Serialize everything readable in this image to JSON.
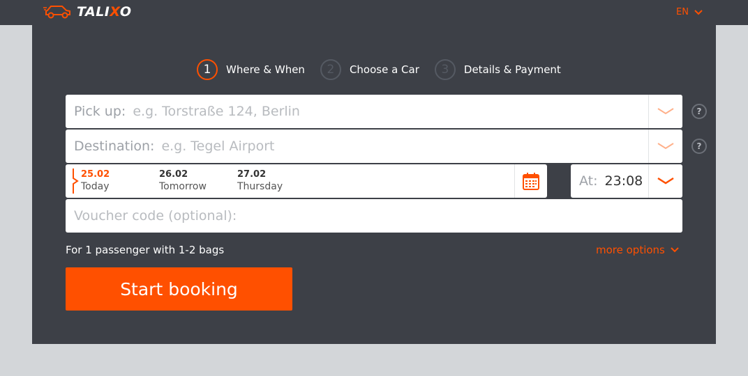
{
  "brand": {
    "name_prefix": "TALI",
    "name_x": "X",
    "name_suffix": "O"
  },
  "header": {
    "language": "EN"
  },
  "steps": [
    {
      "number": "1",
      "label": "Where & When",
      "active": true
    },
    {
      "number": "2",
      "label": "Choose a Car",
      "active": false
    },
    {
      "number": "3",
      "label": "Details & Payment",
      "active": false
    }
  ],
  "form": {
    "pickup": {
      "label": "Pick up:",
      "placeholder": "e.g. Torstraße 124, Berlin",
      "value": "",
      "help": "?"
    },
    "destination": {
      "label": "Destination:",
      "placeholder": "e.g. Tegel Airport",
      "value": "",
      "help": "?"
    },
    "dates": [
      {
        "date": "25.02",
        "weekday": "Today",
        "selected": true
      },
      {
        "date": "26.02",
        "weekday": "Tomorrow",
        "selected": false
      },
      {
        "date": "27.02",
        "weekday": "Thursday",
        "selected": false
      }
    ],
    "time": {
      "label": "At:",
      "value": "23:08"
    },
    "voucher": {
      "placeholder": "Voucher code (optional):",
      "value": ""
    }
  },
  "passengers_text": "For 1 passenger with 1-2 bags",
  "more_options_label": "more options",
  "start_booking_label": "Start booking",
  "colors": {
    "accent": "#ff5000",
    "dark": "#3d4047",
    "background": "#d3d6d9"
  },
  "icons": [
    "taxi-logo-icon",
    "chevron-down-icon",
    "help-icon",
    "calendar-icon"
  ]
}
